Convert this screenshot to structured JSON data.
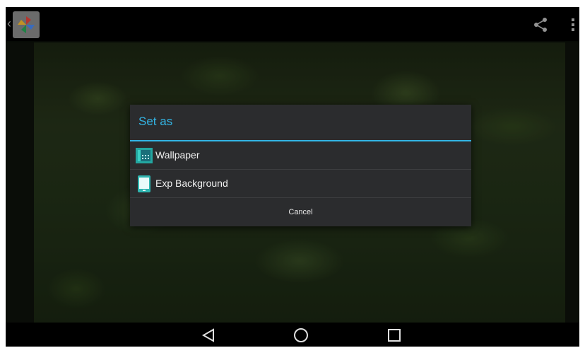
{
  "action_bar": {
    "app_icon": "photos-pinwheel-icon",
    "actions": [
      "share-icon",
      "overflow-menu-icon"
    ]
  },
  "dialog": {
    "title": "Set as",
    "options": [
      {
        "label": "Wallpaper",
        "icon": "wallpaper-icon"
      },
      {
        "label": "Exp Background",
        "icon": "tablet-icon"
      }
    ],
    "cancel_label": "Cancel"
  },
  "nav_bar": {
    "buttons": [
      "back-icon",
      "home-icon",
      "recents-icon"
    ]
  },
  "colors": {
    "accent": "#33b5e5",
    "dialog_bg": "#2b2c2e",
    "bar_bg": "#000000"
  }
}
